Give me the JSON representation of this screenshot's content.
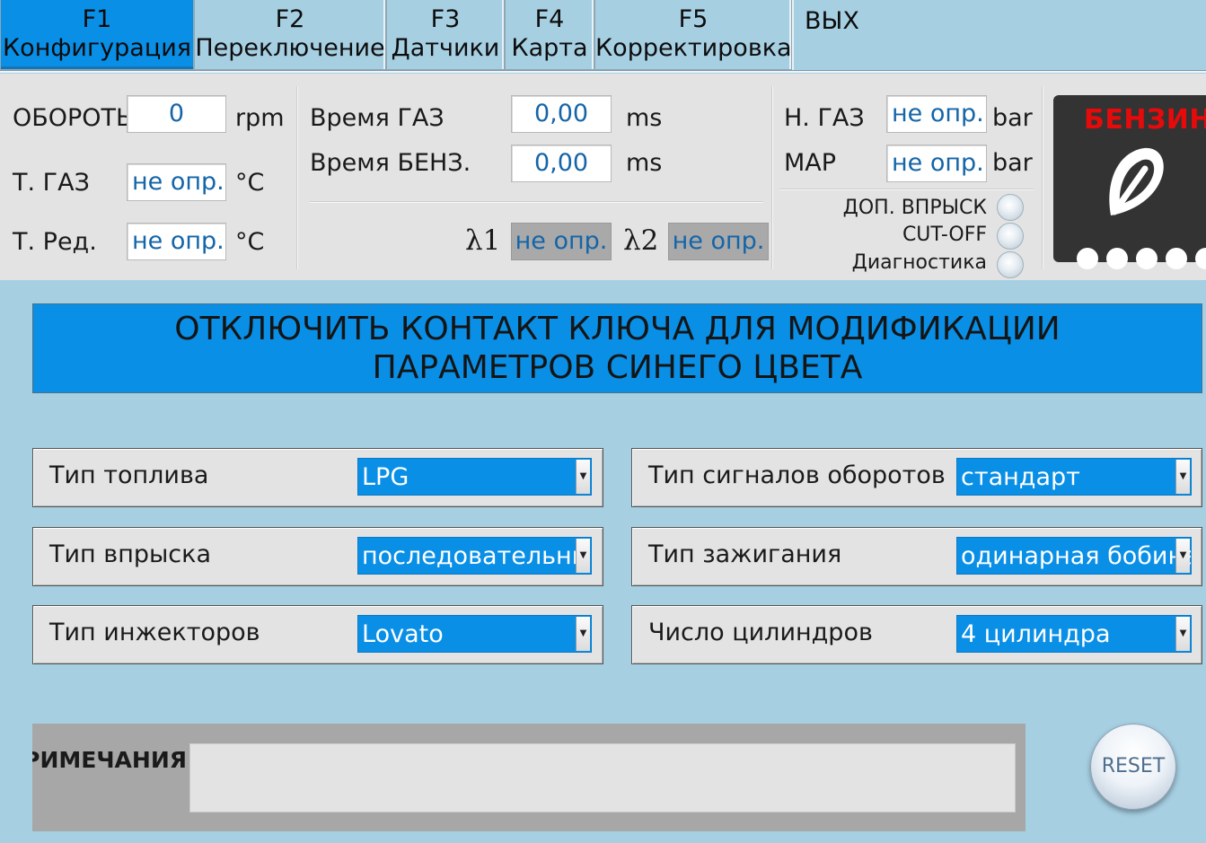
{
  "tabs": [
    {
      "key": "F1",
      "label": "Конфигурация"
    },
    {
      "key": "F2",
      "label": "Переключение"
    },
    {
      "key": "F3",
      "label": "Датчики"
    },
    {
      "key": "F4",
      "label": "Карта"
    },
    {
      "key": "F5",
      "label": "Корректировка"
    }
  ],
  "exit_label": "ВЫХ",
  "status": {
    "rpm_label": "ОБОРОТЫ",
    "rpm_value": "0",
    "rpm_unit": "rpm",
    "t_gas_label": "Т. ГАЗ",
    "t_gas_value": "не опр.",
    "t_gas_unit": "°С",
    "t_red_label": "Т. Ред.",
    "t_red_value": "не опр.",
    "t_red_unit": "°С",
    "time_gas_label": "Время ГАЗ",
    "time_gas_value": "0,00",
    "time_gas_unit": "ms",
    "time_benz_label": "Время БЕНЗ.",
    "time_benz_value": "0,00",
    "time_benz_unit": "ms",
    "lambda1_label": "λ1",
    "lambda1_value": "не опр.",
    "lambda2_label": "λ2",
    "lambda2_value": "не опр.",
    "p_gas_label": "Н. ГАЗ",
    "p_gas_value": "не опр.",
    "p_gas_unit": "bar",
    "map_label": "MAP",
    "map_value": "не опр.",
    "map_unit": "bar",
    "indicators": [
      {
        "label": "ДОП. ВПРЫСК"
      },
      {
        "label": "CUT-OFF"
      },
      {
        "label": "Диагностика"
      }
    ],
    "fuel_mode": "БЕНЗИН",
    "fuel_mode_color": "#e80a0a"
  },
  "banner": {
    "line1": "ОТКЛЮЧИТЬ КОНТАКТ КЛЮЧА ДЛЯ МОДИФИКАЦИИ",
    "line2": "ПАРАМЕТРОВ СИНЕГО ЦВЕТА"
  },
  "config": {
    "fuel_type": {
      "label": "Тип топлива",
      "value": "LPG"
    },
    "injection_type": {
      "label": "Тип впрыска",
      "value": "последовательный"
    },
    "injector_type": {
      "label": "Тип инжекторов",
      "value": "Lovato"
    },
    "rpm_signal_type": {
      "label": "Тип сигналов оборотов",
      "value": "стандарт"
    },
    "ignition_type": {
      "label": "Тип зажигания",
      "value": "одинарная бобина"
    },
    "cylinders": {
      "label": "Число цилиндров",
      "value": "4 цилиндра"
    }
  },
  "notes": {
    "label": "ПРИМЕЧАНИЯ",
    "value": ""
  },
  "reset_label": "RESET",
  "colors": {
    "accent": "#0a8fe6",
    "background": "#a6cfe2",
    "panel": "#e3e3e3",
    "value_text": "#1465a8"
  }
}
